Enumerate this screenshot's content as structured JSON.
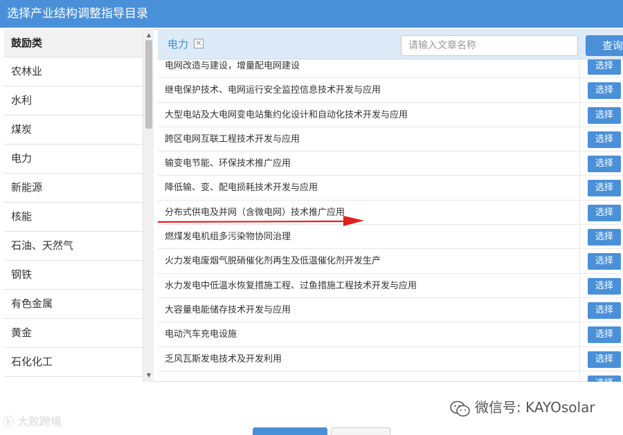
{
  "window": {
    "title": "选择产业结构调整指导目录"
  },
  "sidebar": {
    "items": [
      {
        "label": "鼓励类",
        "header": true
      },
      {
        "label": "农林业"
      },
      {
        "label": "水利"
      },
      {
        "label": "煤炭"
      },
      {
        "label": "电力"
      },
      {
        "label": "新能源"
      },
      {
        "label": "核能"
      },
      {
        "label": "石油、天然气"
      },
      {
        "label": "钢铁"
      },
      {
        "label": "有色金属"
      },
      {
        "label": "黄金"
      },
      {
        "label": "石化化工"
      }
    ]
  },
  "toolbar": {
    "tag_label": "电力",
    "tag_close": "✕",
    "search_placeholder": "请输入文章名称",
    "query_label": "查询"
  },
  "list": {
    "select_label": "选择",
    "rows": [
      "电网改造与建设，增量配电网建设",
      "继电保护技术、电网运行安全监控信息技术开发与应用",
      "大型电站及大电网变电站集约化设计和自动化技术开发与应用",
      "跨区电网互联工程技术开发与应用",
      "输变电节能、环保技术推广应用",
      "降低输、变、配电损耗技术开发与应用",
      "分布式供电及并网（含微电网）技术推广应用",
      "燃煤发电机组多污染物协同治理",
      "火力发电废烟气脱硝催化剂再生及低温催化剂开发生产",
      "水力发电中低温水恢复措施工程、过鱼措施工程技术开发与应用",
      "大容量电能储存技术开发与应用",
      "电动汽车充电设施",
      "乏风瓦斯发电技术及开发利用",
      ""
    ]
  },
  "annotation": {
    "color": "#e02020"
  },
  "watermarks": {
    "wechat": "微信号: KAYOsolar",
    "left": "大败跨境"
  },
  "colors": {
    "accent": "#4a90d9",
    "toolbar_bg": "#ddeaf7"
  }
}
